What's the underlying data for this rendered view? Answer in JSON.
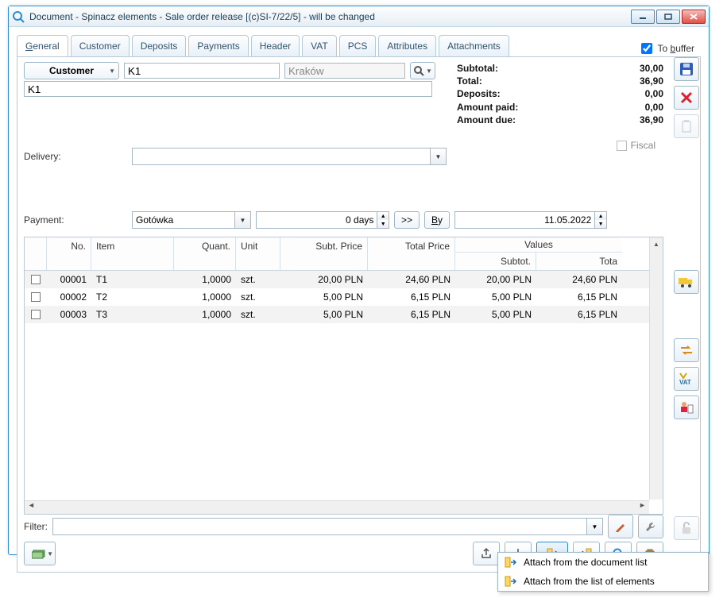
{
  "window": {
    "title": "Document - Spinacz elements - Sale order release [(c)SI-7/22/5]  - will be changed"
  },
  "tabs": [
    "General",
    "Customer",
    "Deposits",
    "Payments",
    "Header",
    "VAT",
    "PCS",
    "Attributes",
    "Attachments"
  ],
  "tobuffer": "To buffer",
  "customer": {
    "btn": "Customer",
    "code": "K1",
    "city": "Kraków",
    "name": "K1"
  },
  "totals": {
    "subtotal_lbl": "Subtotal:",
    "subtotal": "30,00",
    "total_lbl": "Total:",
    "total": "36,90",
    "deposits_lbl": "Deposits:",
    "deposits": "0,00",
    "paid_lbl": "Amount paid:",
    "paid": "0,00",
    "due_lbl": "Amount due:",
    "due": "36,90"
  },
  "fiscal": "Fiscal",
  "delivery_lbl": "Delivery:",
  "payment_lbl": "Payment:",
  "payment_method": "Gotówka",
  "payment_days": "0 days",
  "btn_shift": ">>",
  "btn_by": "By",
  "payment_date": "11.05.2022",
  "grid": {
    "hdr": {
      "no": "No.",
      "item": "Item",
      "qty": "Quant.",
      "unit": "Unit",
      "subp": "Subt. Price",
      "totp": "Total Price",
      "values": "Values",
      "subtot": "Subtot.",
      "tota": "Tota"
    },
    "rows": [
      {
        "no": "00001",
        "item": "T1",
        "qty": "1,0000",
        "unit": "szt.",
        "subp": "20,00 PLN",
        "totp": "24,60 PLN",
        "s": "20,00 PLN",
        "t": "24,60 PLN"
      },
      {
        "no": "00002",
        "item": "T2",
        "qty": "1,0000",
        "unit": "szt.",
        "subp": "5,00 PLN",
        "totp": "6,15 PLN",
        "s": "5,00 PLN",
        "t": "6,15 PLN"
      },
      {
        "no": "00003",
        "item": "T3",
        "qty": "1,0000",
        "unit": "szt.",
        "subp": "5,00 PLN",
        "totp": "6,15 PLN",
        "s": "5,00 PLN",
        "t": "6,15 PLN"
      }
    ]
  },
  "filter_lbl": "Filter:",
  "popup": {
    "item1": "Attach from the document list",
    "item2": "Attach from the list of elements"
  }
}
